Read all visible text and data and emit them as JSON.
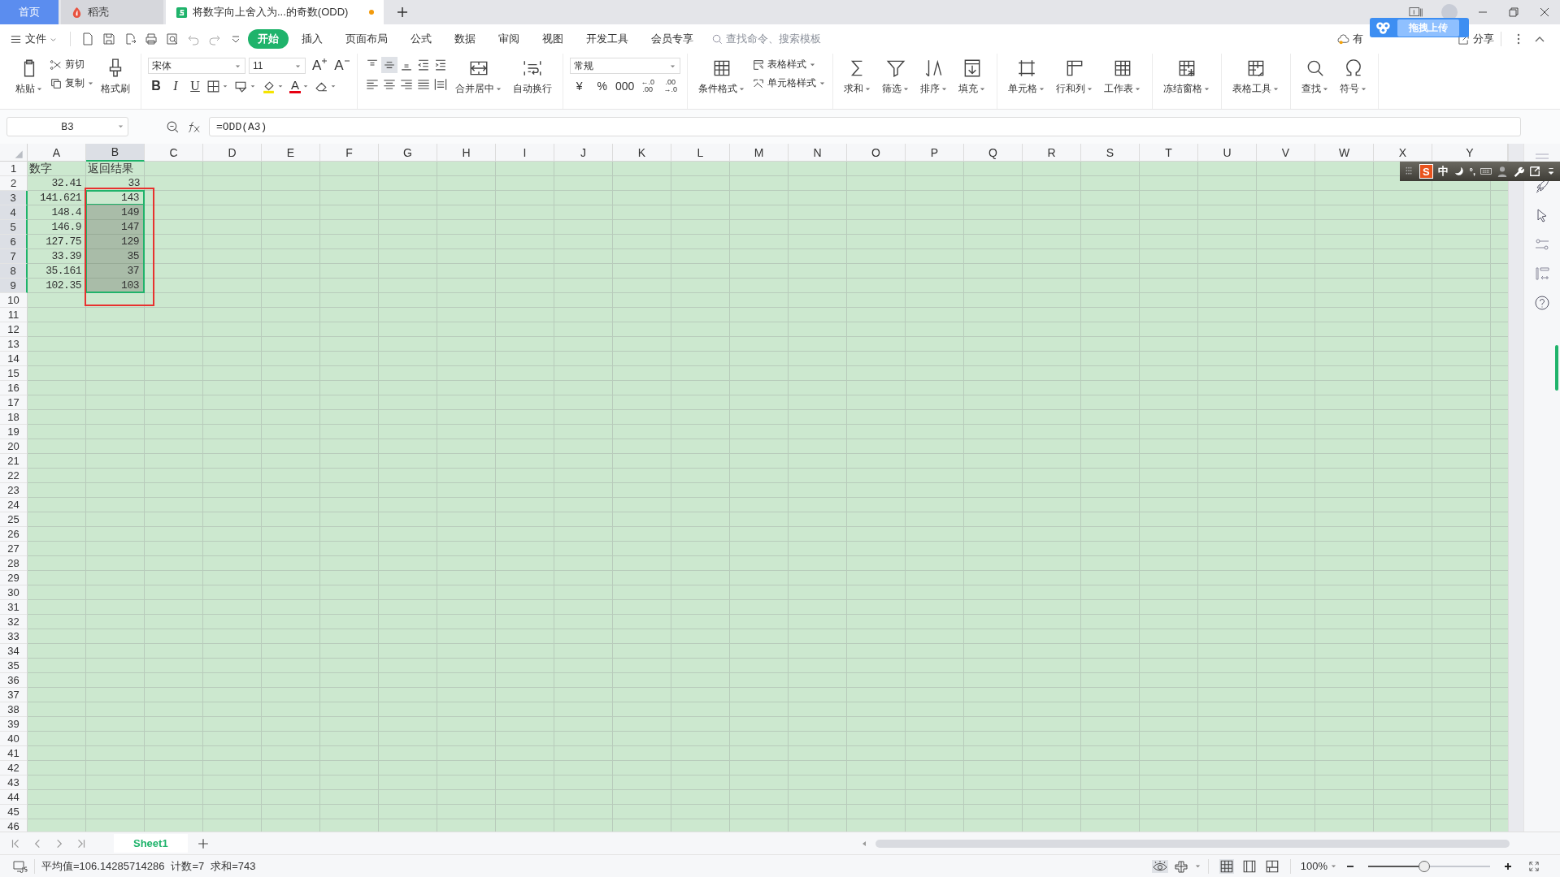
{
  "tabs": [
    {
      "label": "首页",
      "kind": "home",
      "selected": false
    },
    {
      "label": "稻壳",
      "kind": "docer",
      "selected": false
    },
    {
      "label": "将数字向上舍入为...的奇数(ODD)",
      "kind": "sheet",
      "selected": true,
      "unsaved": true
    }
  ],
  "menu": {
    "file": "文件",
    "items": [
      {
        "label": "开始",
        "selected": true
      },
      {
        "label": "插入",
        "selected": false
      },
      {
        "label": "页面布局",
        "selected": false
      },
      {
        "label": "公式",
        "selected": false
      },
      {
        "label": "数据",
        "selected": false
      },
      {
        "label": "审阅",
        "selected": false
      },
      {
        "label": "视图",
        "selected": false
      },
      {
        "label": "开发工具",
        "selected": false
      },
      {
        "label": "会员专享",
        "selected": false
      }
    ],
    "search_placeholder": "查找命令、搜索模板",
    "cloud_label": "有",
    "upload": "拖拽上传",
    "share": "分享"
  },
  "ribbon": [
    {
      "items": [
        {
          "kind": "large",
          "label": "粘贴",
          "caret": true
        },
        {
          "kind": "stack",
          "items": [
            {
              "label": "剪切",
              "caret": false
            },
            {
              "label": "复制",
              "caret": true
            }
          ]
        },
        {
          "kind": "large",
          "label": "格式刷",
          "caret": false
        }
      ]
    },
    {
      "items": [
        {
          "kind": "font",
          "font": "宋体",
          "size": "11",
          "grow": "A",
          "shrink": "A",
          "styles": [
            "B",
            "I",
            "U"
          ],
          "color_letter": "A"
        }
      ]
    },
    {
      "items": [
        {
          "kind": "align",
          "buttons": [
            {
              "selected": false
            },
            {
              "selected": true
            },
            {
              "selected": false
            },
            {
              "selected": false
            },
            {
              "selected": false
            },
            {
              "selected": false
            },
            {
              "selected": false
            },
            {
              "selected": false
            },
            {
              "selected": false
            },
            {
              "selected": false
            }
          ]
        },
        {
          "kind": "large",
          "label": "合并居中",
          "caret": true
        },
        {
          "kind": "large",
          "label": "自动换行",
          "caret": false
        }
      ]
    },
    {
      "items": [
        {
          "kind": "number",
          "format": "常规",
          "buttons": [
            "¥",
            "%",
            "000"
          ],
          "decimals": [
            {
              "top": "←.0",
              "bottom": ".00"
            },
            {
              "top": ".00",
              "bottom": "→.0"
            }
          ]
        }
      ]
    },
    {
      "items": [
        {
          "kind": "large",
          "label": "条件格式",
          "caret": true
        },
        {
          "kind": "stack",
          "items": [
            {
              "label": "表格样式",
              "caret": true
            },
            {
              "label": "单元格样式",
              "caret": true
            }
          ]
        }
      ]
    },
    {
      "items": [
        {
          "kind": "large",
          "label": "求和",
          "caret": true
        },
        {
          "kind": "large",
          "label": "筛选",
          "caret": true
        },
        {
          "kind": "large",
          "label": "排序",
          "caret": true
        },
        {
          "kind": "large",
          "label": "填充",
          "caret": true
        }
      ]
    },
    {
      "items": [
        {
          "kind": "large",
          "label": "单元格",
          "caret": true
        },
        {
          "kind": "large",
          "label": "行和列",
          "caret": true
        },
        {
          "kind": "large",
          "label": "工作表",
          "caret": true
        }
      ]
    },
    {
      "items": [
        {
          "kind": "large",
          "label": "冻结窗格",
          "caret": true
        }
      ]
    },
    {
      "items": [
        {
          "kind": "large",
          "label": "表格工具",
          "caret": true
        }
      ]
    },
    {
      "items": [
        {
          "kind": "large",
          "label": "查找",
          "caret": true
        },
        {
          "kind": "large",
          "label": "符号",
          "caret": true
        }
      ]
    }
  ],
  "formula_bar": {
    "name_box": "B3",
    "formula": "=ODD(A3)"
  },
  "grid": {
    "columns": [
      {
        "label": "A",
        "selected": false
      },
      {
        "label": "B",
        "selected": true
      },
      {
        "label": "C",
        "selected": false
      },
      {
        "label": "D",
        "selected": false
      },
      {
        "label": "E",
        "selected": false
      },
      {
        "label": "F",
        "selected": false
      },
      {
        "label": "G",
        "selected": false
      },
      {
        "label": "H",
        "selected": false
      },
      {
        "label": "I",
        "selected": false
      },
      {
        "label": "J",
        "selected": false
      },
      {
        "label": "K",
        "selected": false
      },
      {
        "label": "L",
        "selected": false
      },
      {
        "label": "M",
        "selected": false
      },
      {
        "label": "N",
        "selected": false
      },
      {
        "label": "O",
        "selected": false
      },
      {
        "label": "P",
        "selected": false
      },
      {
        "label": "Q",
        "selected": false
      },
      {
        "label": "R",
        "selected": false
      },
      {
        "label": "S",
        "selected": false
      },
      {
        "label": "T",
        "selected": false
      },
      {
        "label": "U",
        "selected": false
      },
      {
        "label": "V",
        "selected": false
      },
      {
        "label": "W",
        "selected": false
      },
      {
        "label": "X",
        "selected": false
      },
      {
        "label": "Y",
        "selected": false
      }
    ],
    "rows": [
      {
        "label": "1",
        "selected": false,
        "cells": [
          {
            "text": "数字",
            "kind": "text",
            "selected": false,
            "active": false
          },
          {
            "text": "返回结果",
            "kind": "text",
            "selected": false,
            "active": false
          }
        ]
      },
      {
        "label": "2",
        "selected": false,
        "cells": [
          {
            "text": "32.41",
            "kind": "number",
            "selected": false,
            "active": false
          },
          {
            "text": "33",
            "kind": "number",
            "selected": false,
            "active": false
          }
        ]
      },
      {
        "label": "3",
        "selected": true,
        "cells": [
          {
            "text": "141.621",
            "kind": "number",
            "selected": false,
            "active": false
          },
          {
            "text": "143",
            "kind": "number",
            "selected": true,
            "active": true
          }
        ]
      },
      {
        "label": "4",
        "selected": true,
        "cells": [
          {
            "text": "148.4",
            "kind": "number",
            "selected": false,
            "active": false
          },
          {
            "text": "149",
            "kind": "number",
            "selected": true,
            "active": false
          }
        ]
      },
      {
        "label": "5",
        "selected": true,
        "cells": [
          {
            "text": "146.9",
            "kind": "number",
            "selected": false,
            "active": false
          },
          {
            "text": "147",
            "kind": "number",
            "selected": true,
            "active": false
          }
        ]
      },
      {
        "label": "6",
        "selected": true,
        "cells": [
          {
            "text": "127.75",
            "kind": "number",
            "selected": false,
            "active": false
          },
          {
            "text": "129",
            "kind": "number",
            "selected": true,
            "active": false
          }
        ]
      },
      {
        "label": "7",
        "selected": true,
        "cells": [
          {
            "text": "33.39",
            "kind": "number",
            "selected": false,
            "active": false
          },
          {
            "text": "35",
            "kind": "number",
            "selected": true,
            "active": false
          }
        ]
      },
      {
        "label": "8",
        "selected": true,
        "cells": [
          {
            "text": "35.161",
            "kind": "number",
            "selected": false,
            "active": false
          },
          {
            "text": "37",
            "kind": "number",
            "selected": true,
            "active": false
          }
        ]
      },
      {
        "label": "9",
        "selected": true,
        "cells": [
          {
            "text": "102.35",
            "kind": "number",
            "selected": false,
            "active": false
          },
          {
            "text": "103",
            "kind": "number",
            "selected": true,
            "active": false
          }
        ]
      },
      {
        "label": "10",
        "selected": false
      },
      {
        "label": "11",
        "selected": false
      },
      {
        "label": "12",
        "selected": false
      },
      {
        "label": "13",
        "selected": false
      },
      {
        "label": "14",
        "selected": false
      },
      {
        "label": "15",
        "selected": false
      },
      {
        "label": "16",
        "selected": false
      },
      {
        "label": "17",
        "selected": false
      },
      {
        "label": "18",
        "selected": false
      },
      {
        "label": "19",
        "selected": false
      },
      {
        "label": "20",
        "selected": false
      },
      {
        "label": "21",
        "selected": false
      },
      {
        "label": "22",
        "selected": false
      },
      {
        "label": "23",
        "selected": false
      },
      {
        "label": "24",
        "selected": false
      },
      {
        "label": "25",
        "selected": false
      },
      {
        "label": "26",
        "selected": false
      },
      {
        "label": "27",
        "selected": false
      },
      {
        "label": "28",
        "selected": false
      },
      {
        "label": "29",
        "selected": false
      },
      {
        "label": "30",
        "selected": false
      },
      {
        "label": "31",
        "selected": false
      },
      {
        "label": "32",
        "selected": false
      },
      {
        "label": "33",
        "selected": false
      },
      {
        "label": "34",
        "selected": false
      },
      {
        "label": "35",
        "selected": false
      },
      {
        "label": "36",
        "selected": false
      },
      {
        "label": "37",
        "selected": false
      },
      {
        "label": "38",
        "selected": false
      },
      {
        "label": "39",
        "selected": false
      },
      {
        "label": "40",
        "selected": false
      },
      {
        "label": "41",
        "selected": false
      },
      {
        "label": "42",
        "selected": false
      },
      {
        "label": "43",
        "selected": false
      },
      {
        "label": "44",
        "selected": false
      },
      {
        "label": "45",
        "selected": false
      },
      {
        "label": "46",
        "selected": false
      }
    ]
  },
  "ime": {
    "logo": "S",
    "mode": "中",
    "punct": "°,"
  },
  "sheets": [
    {
      "label": "Sheet1",
      "selected": true
    }
  ],
  "status_bar": {
    "texts": [
      "平均值=106.14285714286",
      "计数=7",
      "求和=743"
    ],
    "zoom": {
      "label": "100%",
      "level": 0.46
    }
  }
}
